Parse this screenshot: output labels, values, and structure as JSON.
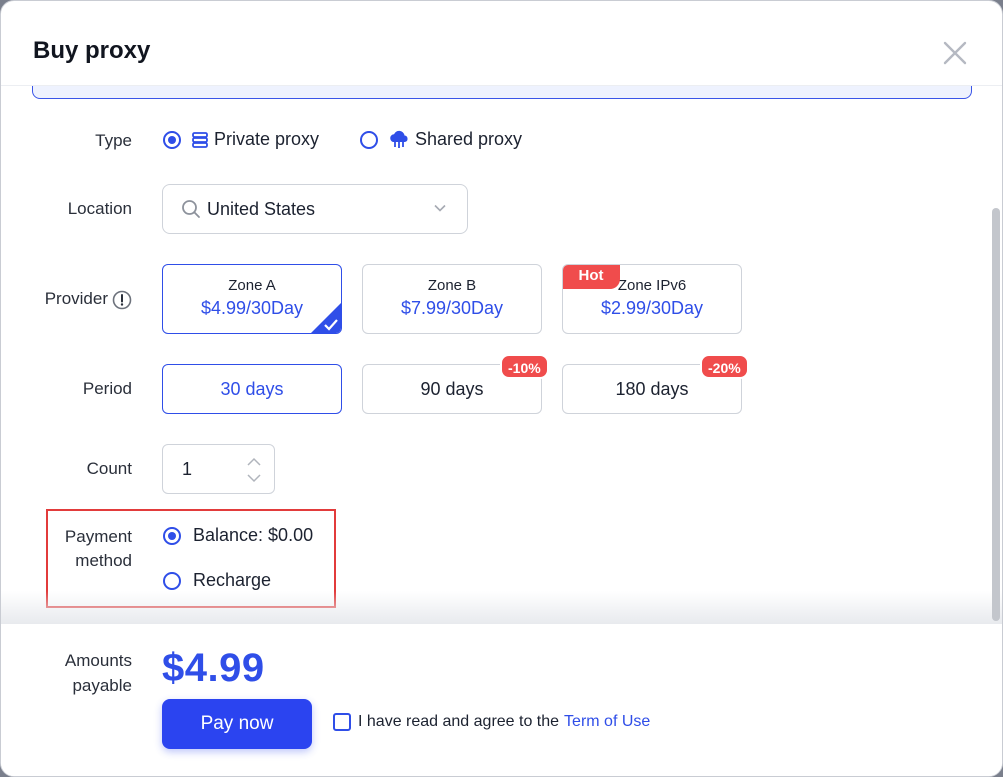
{
  "title": "Buy proxy",
  "type": {
    "label": "Type",
    "options": [
      {
        "label": "Private proxy",
        "icon": "server-icon",
        "selected": true
      },
      {
        "label": "Shared proxy",
        "icon": "cloud-icon",
        "selected": false
      }
    ]
  },
  "location": {
    "label": "Location",
    "value": "United States"
  },
  "provider": {
    "label": "Provider",
    "cards": [
      {
        "zone": "Zone A",
        "price": "$4.99/30Day",
        "selected": true
      },
      {
        "zone": "Zone B",
        "price": "$7.99/30Day",
        "selected": false
      },
      {
        "zone": "Zone IPv6",
        "price": "$2.99/30Day",
        "selected": false,
        "badge": "Hot"
      }
    ]
  },
  "period": {
    "label": "Period",
    "options": [
      {
        "label": "30 days",
        "selected": true
      },
      {
        "label": "90 days",
        "discount": "-10%"
      },
      {
        "label": "180 days",
        "discount": "-20%"
      }
    ]
  },
  "count": {
    "label": "Count",
    "value": "1"
  },
  "payment": {
    "label_line1": "Payment",
    "label_line2": "method",
    "options": [
      {
        "label": "Balance: $0.00",
        "selected": true
      },
      {
        "label": "Recharge",
        "selected": false
      }
    ]
  },
  "footer": {
    "amount_label_line1": "Amounts",
    "amount_label_line2": "payable",
    "amount": "$4.99",
    "pay_button": "Pay now",
    "agree_text": "I have read and agree to the",
    "terms_link": "Term of Use"
  },
  "colors": {
    "accent": "#2f4ee8",
    "badge_red": "#f04c4c",
    "highlight_box": "#e23b3b"
  }
}
